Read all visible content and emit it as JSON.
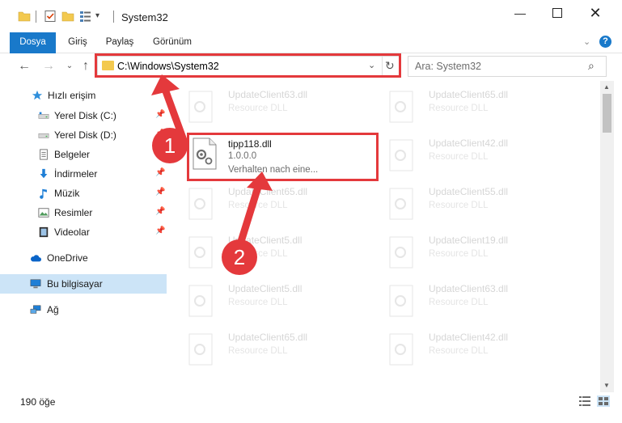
{
  "window": {
    "title": "System32",
    "minimize_icon": "minimize-icon",
    "maximize_icon": "maximize-icon",
    "close_icon": "close-icon"
  },
  "ribbon": {
    "tabs": [
      "Dosya",
      "Giriş",
      "Paylaş",
      "Görünüm"
    ],
    "accent": "#1979ca",
    "help_label": "?"
  },
  "navigation": {
    "back_icon": "arrow-left-icon",
    "forward_icon": "arrow-right-icon",
    "recent_icon": "chevron-down-icon",
    "up_icon": "arrow-up-icon",
    "address_path": "C:\\Windows\\System32",
    "search_placeholder": "Ara: System32"
  },
  "sidebar": {
    "items": [
      {
        "label": "Hızlı erişim",
        "icon": "star-icon",
        "pinned": false
      },
      {
        "label": "Yerel Disk (C:)",
        "icon": "drive-icon",
        "pinned": true
      },
      {
        "label": "Yerel Disk (D:)",
        "icon": "drive-icon",
        "pinned": true
      },
      {
        "label": "Belgeler",
        "icon": "documents-icon",
        "pinned": true
      },
      {
        "label": "İndirmeler",
        "icon": "download-icon",
        "pinned": true
      },
      {
        "label": "Müzik",
        "icon": "music-icon",
        "pinned": true
      },
      {
        "label": "Resimler",
        "icon": "pictures-icon",
        "pinned": true
      },
      {
        "label": "Videolar",
        "icon": "video-icon",
        "pinned": true
      },
      {
        "label": "OneDrive",
        "icon": "cloud-icon",
        "pinned": false
      },
      {
        "label": "Bu bilgisayar",
        "icon": "computer-icon",
        "pinned": false,
        "selected": true
      },
      {
        "label": "Ağ",
        "icon": "network-icon",
        "pinned": false
      }
    ]
  },
  "files": {
    "selected": {
      "name": "tipp118.dll",
      "version": "1.0.0.0",
      "description": "Verhalten nach eine..."
    },
    "left_column": [
      {
        "name": "UpdateClient63.dll",
        "desc": "Resource DLL"
      },
      {
        "name": "UpdateClient65.dll",
        "desc": "Resource DLL"
      },
      {
        "name": "UpdateClient5.dll",
        "desc": "Resource DLL"
      },
      {
        "name": "UpdateClient5.dll",
        "desc": "Resource DLL"
      },
      {
        "name": "UpdateClient65.dll",
        "desc": "Resource DLL"
      }
    ],
    "right_column": [
      {
        "name": "UpdateClient65.dll",
        "desc": "Resource DLL"
      },
      {
        "name": "UpdateClient42.dll",
        "desc": "Resource DLL"
      },
      {
        "name": "UpdateClient55.dll",
        "desc": "Resource DLL"
      },
      {
        "name": "UpdateClient19.dll",
        "desc": "Resource DLL"
      },
      {
        "name": "UpdateClient63.dll",
        "desc": "Resource DLL"
      },
      {
        "name": "UpdateClient42.dll",
        "desc": "Resource DLL"
      }
    ]
  },
  "annotations": {
    "step1": "1",
    "step2": "2",
    "color": "#e4393c"
  },
  "status": {
    "item_count": "190 öğe"
  }
}
